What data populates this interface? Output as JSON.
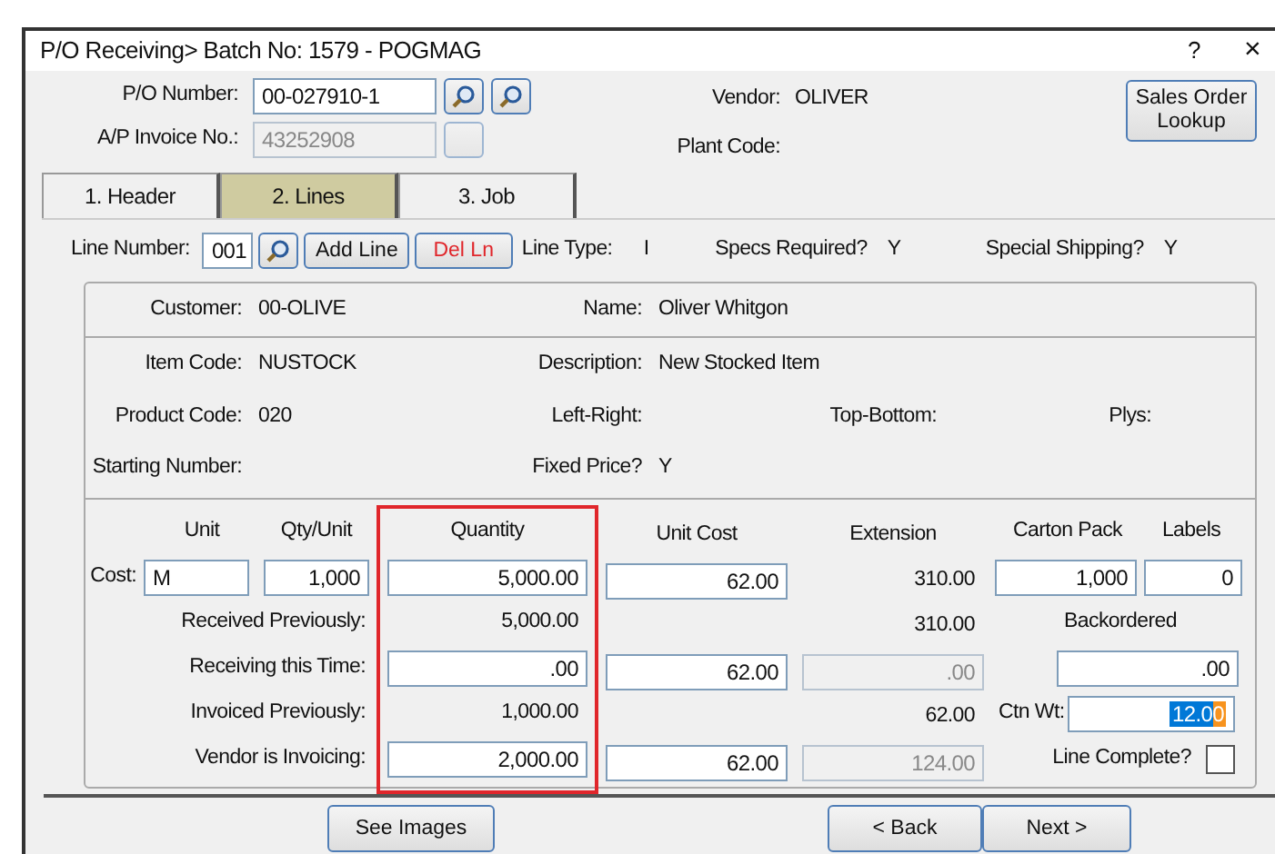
{
  "window": {
    "title": "P/O Receiving> Batch No: 1579 - POGMAG",
    "help": "?",
    "close": "×"
  },
  "header": {
    "po_number": {
      "label": "P/O Number:",
      "value": "00-027910-1"
    },
    "ap_invoice": {
      "label": "A/P Invoice No.:",
      "value": "43252908",
      "disabled": true
    },
    "vendor": {
      "label": "Vendor:",
      "value": "OLIVER"
    },
    "plant_code": {
      "label": "Plant Code:"
    },
    "lookup_button": "Sales Order Lookup"
  },
  "tabs": [
    {
      "label": "1. Header",
      "selected": false
    },
    {
      "label": "2. Lines",
      "selected": true
    },
    {
      "label": "3. Job",
      "selected": false
    }
  ],
  "line": {
    "label": "Line Number:",
    "value": "001",
    "add_button": "Add Line",
    "delete_button": "Del Ln",
    "info": [
      {
        "label": "Line Type:",
        "value": "I"
      },
      {
        "label": "Specs Required?",
        "value": "Y"
      },
      {
        "label": "Special Shipping?",
        "value": "Y"
      }
    ]
  },
  "customer": [
    {
      "label": "Customer:",
      "value": "00-OLIVE"
    },
    {
      "label": "Name:",
      "value": "Oliver Whitgon"
    }
  ],
  "item_rows": [
    [
      {
        "label": "Item Code:",
        "value": "NUSTOCK"
      },
      {
        "label": "Description:",
        "value": "New Stocked Item"
      }
    ],
    [
      {
        "label": "Product Code:",
        "value": "020"
      },
      {
        "label": "Left-Right:"
      },
      {
        "label": "Top-Bottom:"
      },
      {
        "label": "Plys:"
      }
    ],
    [
      {
        "label": "Starting Number:"
      },
      {
        "label": "Fixed Price?",
        "value": "Y"
      }
    ]
  ],
  "cost_table": {
    "unit_header": "Unit",
    "qty_unit_header": "Qty/Unit",
    "cost_label": "Cost:",
    "unit": "M",
    "qty_unit": "1,000",
    "row_labels": [
      "Received Previously:",
      "Receiving this Time:",
      "Invoiced Previously:",
      "Vendor is Invoicing:"
    ],
    "columns": [
      {
        "header": "Quantity",
        "highlighted": true,
        "cells": [
          {
            "kind": "field",
            "value": "5,000.00"
          },
          {
            "kind": "text",
            "value": "5,000.00"
          },
          {
            "kind": "field",
            "value": ".00"
          },
          {
            "kind": "text",
            "value": "1,000.00"
          },
          {
            "kind": "field",
            "value": "2,000.00"
          }
        ]
      },
      {
        "header": "Unit Cost",
        "highlighted": false,
        "cells": [
          {
            "kind": "field",
            "value": "62.00"
          },
          {
            "kind": "blank"
          },
          {
            "kind": "field",
            "value": "62.00"
          },
          {
            "kind": "blank"
          },
          {
            "kind": "field",
            "value": "62.00"
          }
        ]
      },
      {
        "header": "Extension",
        "highlighted": false,
        "cells": [
          {
            "kind": "text",
            "value": "310.00"
          },
          {
            "kind": "text",
            "value": "310.00"
          },
          {
            "kind": "disabled",
            "value": ".00"
          },
          {
            "kind": "text",
            "value": "62.00"
          },
          {
            "kind": "disabled",
            "value": "124.00"
          }
        ]
      }
    ],
    "carton_pack": {
      "header": "Carton Pack",
      "value": "1,000"
    },
    "labels": {
      "header": "Labels",
      "value": "0"
    },
    "backordered": {
      "label": "Backordered",
      "value": ".00"
    },
    "ctn_wt": {
      "label": "Ctn Wt:",
      "value": "12.00",
      "selected": true
    },
    "line_complete": {
      "label": "Line Complete?",
      "checked": false
    }
  },
  "buttons": {
    "see_images": "See Images",
    "back": "< Back",
    "next": "Next >"
  }
}
